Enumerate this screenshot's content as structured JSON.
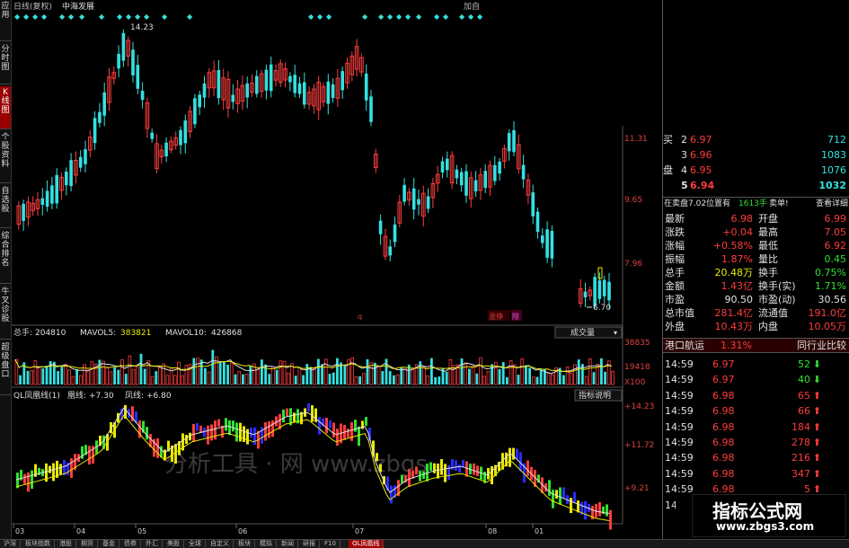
{
  "left_tabs": [
    {
      "label": "应用"
    },
    {
      "label": "分时图"
    },
    {
      "label": "K线图",
      "active": true
    },
    {
      "label": "个股资料"
    },
    {
      "label": "自选股"
    },
    {
      "label": "综合排名"
    },
    {
      "label": "牛叉诊股"
    },
    {
      "label": "超级盘口"
    }
  ],
  "header": {
    "title": "日线(复权)",
    "stock": "中海发展",
    "top_right": "加自"
  },
  "price_chart": {
    "high_label": "14.23",
    "low_label": "6.70",
    "right_ticks": [
      "11.31",
      "9.65",
      "7.96"
    ],
    "marks": [
      "q",
      "涨停",
      "除"
    ]
  },
  "volume_panel": {
    "label_total": "总手:",
    "total": "204810",
    "label_ma5": "MAVOL5:",
    "ma5": "383821",
    "label_ma10": "MAVOL10:",
    "ma10": "426868",
    "dropdown": "成交量",
    "right_ticks": [
      "38835",
      "19418",
      "X100"
    ]
  },
  "indicator_panel": {
    "label": "QL凤凰线(1)",
    "huang_label": "凰线:",
    "huang": "+7.30",
    "feng_label": "凤线:",
    "feng": "+6.80",
    "button": "指标说明",
    "right_ticks": [
      "+14.23",
      "+11.72",
      "+9.21"
    ],
    "watermark": "分析工具 · 网 www.zbgs"
  },
  "x_axis": [
    "03",
    "04",
    "05",
    "06",
    "07",
    "08",
    "01"
  ],
  "order_book": [
    {
      "side": "买",
      "level": "2",
      "price": "6.97",
      "vol": "712"
    },
    {
      "side": "",
      "level": "3",
      "price": "6.96",
      "vol": "1083"
    },
    {
      "side": "盘",
      "level": "4",
      "price": "6.95",
      "vol": "1076"
    },
    {
      "side": "",
      "level": "5",
      "price": "6.94",
      "vol": "1032"
    }
  ],
  "order_info": {
    "text": "在卖盘7.02位置有",
    "vol": "1613手",
    "sell": "卖单!",
    "detail": "查看详细"
  },
  "quote": [
    {
      "l": "最新",
      "v": "6.98",
      "l2": "开盘",
      "v2": "6.99"
    },
    {
      "l": "涨跌",
      "v": "+0.04",
      "l2": "最高",
      "v2": "7.05"
    },
    {
      "l": "涨幅",
      "v": "+0.58%",
      "l2": "最低",
      "v2": "6.92"
    },
    {
      "l": "振幅",
      "v": "1.87%",
      "l2": "量比",
      "v2": "0.45"
    },
    {
      "l": "总手",
      "v": "20.48万",
      "l2": "换手",
      "v2": "0.75%"
    },
    {
      "l": "金额",
      "v": "1.43亿",
      "l2": "换手(实)",
      "v2": "1.71%"
    },
    {
      "l": "市盈",
      "v": "90.50",
      "l2": "市盈(动)",
      "v2": "30.56"
    },
    {
      "l": "总市值",
      "v": "281.4亿",
      "l2": "流通值",
      "v2": "191.0亿"
    },
    {
      "l": "外盘",
      "v": "10.43万",
      "l2": "内盘",
      "v2": "10.05万"
    }
  ],
  "sector": {
    "name": "港口航运",
    "pct": "1.31%",
    "compare": "同行业比较"
  },
  "ticks": [
    {
      "t": "14:59",
      "p": "6.97",
      "v": "52",
      "dir": "down"
    },
    {
      "t": "14:59",
      "p": "6.97",
      "v": "40",
      "dir": "down"
    },
    {
      "t": "14:59",
      "p": "6.98",
      "v": "65",
      "dir": "up"
    },
    {
      "t": "14:59",
      "p": "6.98",
      "v": "66",
      "dir": "up"
    },
    {
      "t": "14:59",
      "p": "6.98",
      "v": "184",
      "dir": "up"
    },
    {
      "t": "14:59",
      "p": "6.98",
      "v": "278",
      "dir": "up"
    },
    {
      "t": "14:59",
      "p": "6.98",
      "v": "216",
      "dir": "up"
    },
    {
      "t": "14:59",
      "p": "6.98",
      "v": "347",
      "dir": "up"
    },
    {
      "t": "14:59",
      "p": "6.98",
      "v": "5",
      "dir": "up"
    },
    {
      "t": "14:59",
      "p": "6.98",
      "v": "3",
      "dir": "up"
    }
  ],
  "watermark_box": {
    "line1": "指标公式网",
    "line2": "www.zbgs3.com"
  },
  "bottom_tabs": [
    {
      "label": "沪深"
    },
    {
      "label": "板块指数"
    },
    {
      "label": "港股"
    },
    {
      "label": "期货"
    },
    {
      "label": "基金"
    },
    {
      "label": "债券"
    },
    {
      "label": "外汇"
    },
    {
      "label": "美股"
    },
    {
      "label": "全球"
    },
    {
      "label": "自定义"
    },
    {
      "label": "板块"
    },
    {
      "label": "模拟"
    },
    {
      "label": "新闻"
    },
    {
      "label": "研报"
    },
    {
      "label": "F10"
    },
    {
      "label": "QL凤凰线",
      "active": true
    }
  ],
  "colors": {
    "up": "#ff3c3c",
    "down": "#34e0e0",
    "ma": "#e0e0e0",
    "green": "#30e030",
    "yellow": "#e8e800",
    "blue": "#2b2bff"
  }
}
